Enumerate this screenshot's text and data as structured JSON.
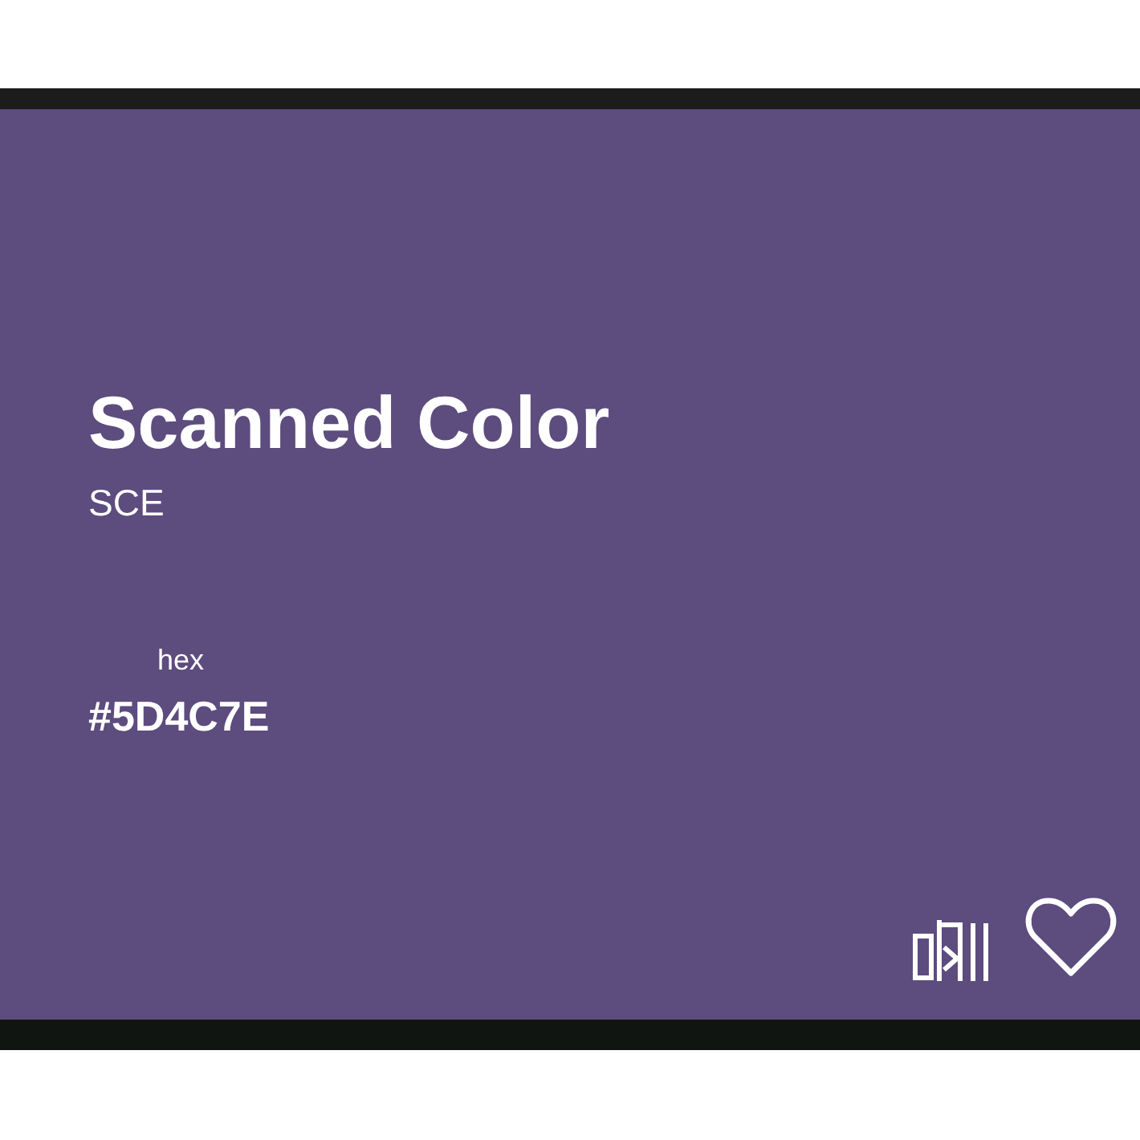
{
  "card": {
    "color": "#5d4c7e",
    "title": "Scanned Color",
    "code": "SCE",
    "hex_label": "hex",
    "hex_value": "#5D4C7E"
  },
  "actions": {
    "favorite": {
      "selected": false
    }
  }
}
